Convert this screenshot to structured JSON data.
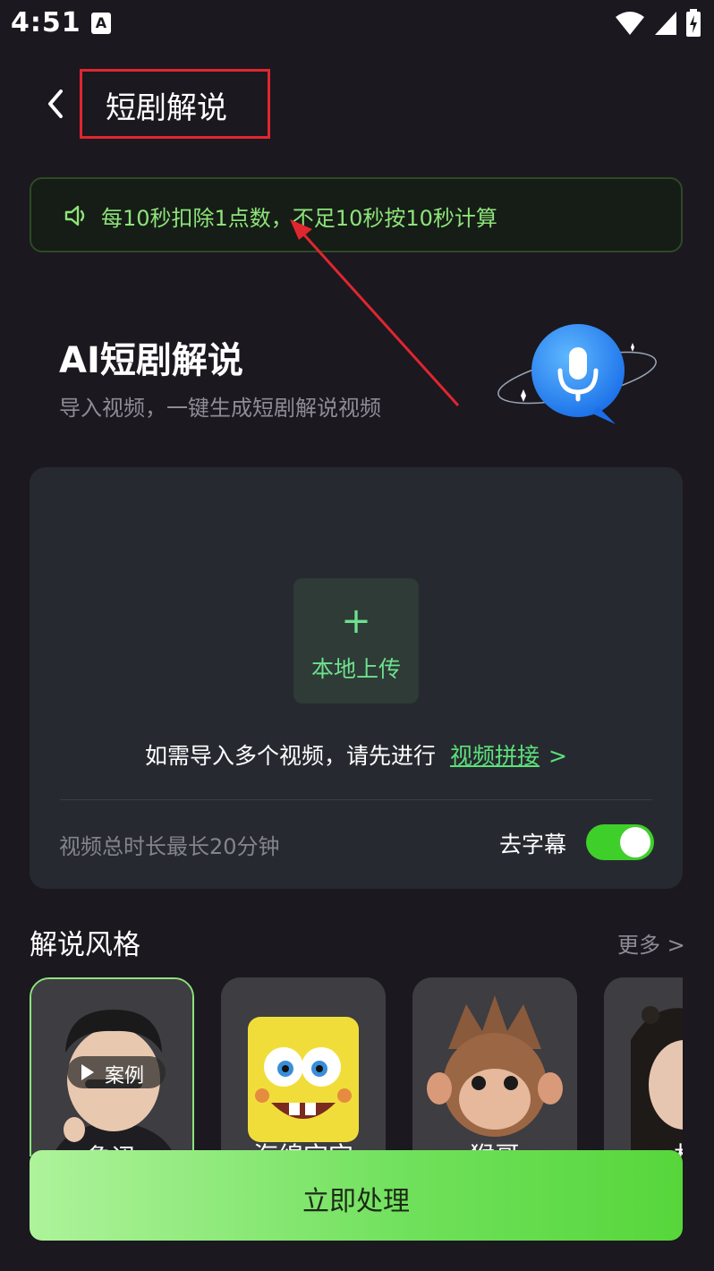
{
  "status_bar": {
    "time": "4:51",
    "notification_icon": "a-icon",
    "icons": [
      "wifi-icon",
      "signal-icon",
      "battery-icon"
    ]
  },
  "header": {
    "title": "短剧解说",
    "back_icon": "chevron-left-icon"
  },
  "notice": {
    "icon": "speaker-icon",
    "text": "每10秒扣除1点数，不足10秒按10秒计算"
  },
  "hero": {
    "title": "AI短剧解说",
    "subtitle": "导入视频，一键生成短剧解说视频",
    "illustration": "microphone-bubble-icon"
  },
  "upload": {
    "plus_icon": "plus-icon",
    "button_label": "本地上传",
    "multi_text": "如需导入多个视频，请先进行",
    "multi_link": "视频拼接",
    "multi_chevron": ">",
    "duration_text": "视频总时长最长20分钟",
    "subtitle_toggle_label": "去字幕",
    "subtitle_toggle_on": true
  },
  "styles": {
    "section_title": "解说风格",
    "more_label": "更多 >",
    "case_badge": "案例",
    "items": [
      {
        "name": "鲁迅",
        "selected": true
      },
      {
        "name": "海绵宝宝",
        "selected": false
      },
      {
        "name": "猴哥",
        "selected": false
      },
      {
        "name": "林",
        "selected": false
      }
    ]
  },
  "primary_button": {
    "label": "立即处理"
  },
  "colors": {
    "background": "#1b1820",
    "accent_green": "#5ce07a",
    "notice_text": "#8ee37a",
    "annotation_red": "#e0262f"
  }
}
